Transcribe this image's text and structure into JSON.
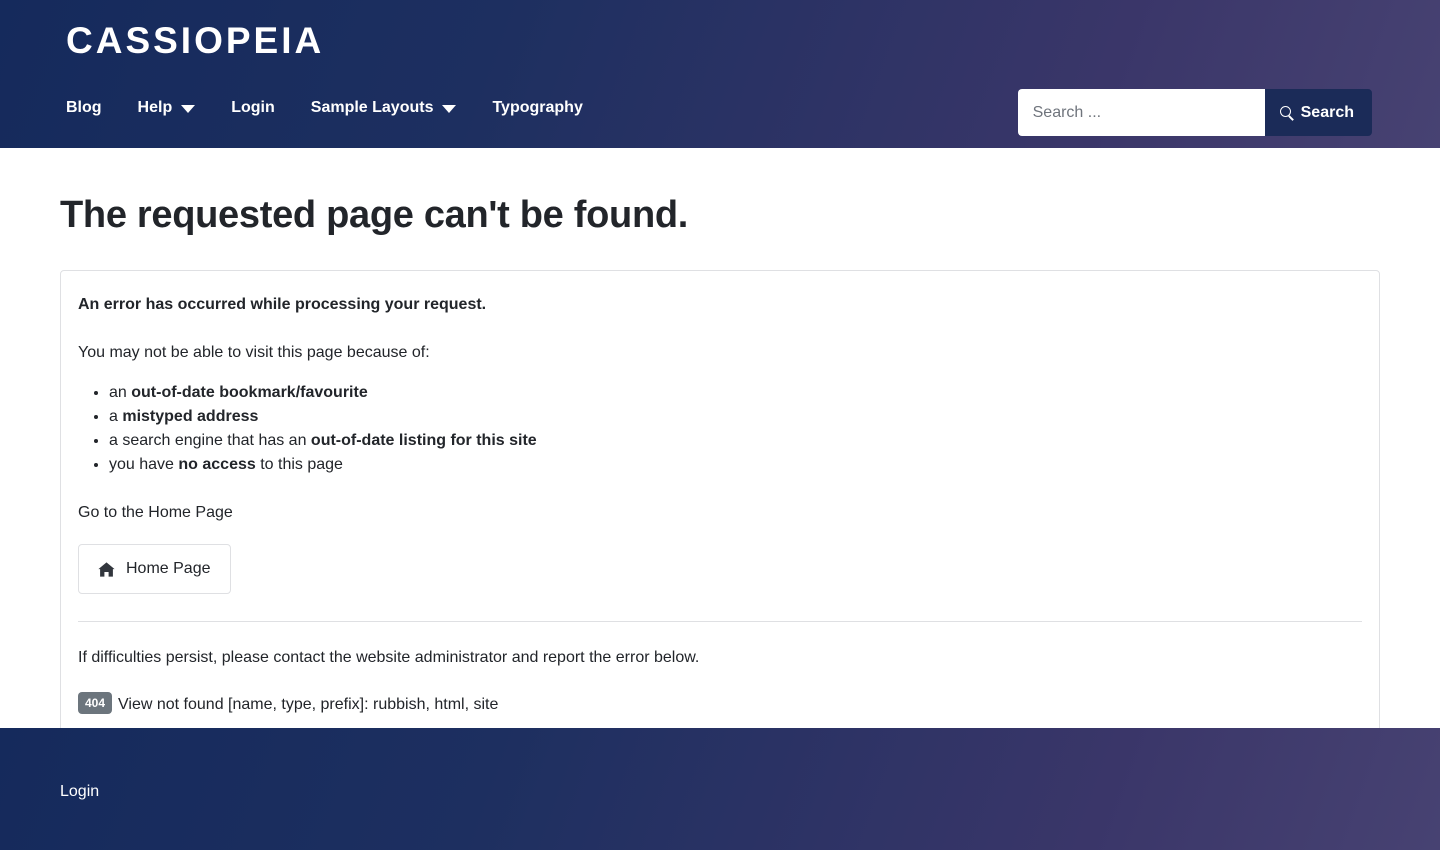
{
  "header": {
    "brand": "CASSIOPEIA",
    "nav": [
      {
        "label": "Blog",
        "has_dropdown": false
      },
      {
        "label": "Help",
        "has_dropdown": true
      },
      {
        "label": "Login",
        "has_dropdown": false
      },
      {
        "label": "Sample Layouts",
        "has_dropdown": true
      },
      {
        "label": "Typography",
        "has_dropdown": false
      }
    ],
    "search": {
      "placeholder": "Search ...",
      "value": "",
      "button_label": "Search",
      "button_icon": "search-icon"
    },
    "gradient_from": "#152a5c",
    "gradient_to": "#474272"
  },
  "main": {
    "page_title": "The requested page can't be found.",
    "error_card": {
      "lead": "An error has occurred while processing your request.",
      "intro": "You may not be able to visit this page because of:",
      "reasons": [
        {
          "prefix": "an ",
          "strong": "out-of-date bookmark/favourite",
          "suffix": ""
        },
        {
          "prefix": "a ",
          "strong": "mistyped address",
          "suffix": ""
        },
        {
          "prefix": "a search engine that has an ",
          "strong": "out-of-date listing for this site",
          "suffix": ""
        },
        {
          "prefix": "you have ",
          "strong": "no access",
          "suffix": " to this page"
        }
      ],
      "home_prompt": "Go to the Home Page",
      "home_button": {
        "label": "Home Page",
        "icon": "home-icon"
      },
      "persist_note": "If difficulties persist, please contact the website administrator and report the error below.",
      "error_code": "404",
      "error_code_color": "#6c757d",
      "error_message": "View not found [name, type, prefix]: rubbish, html, site"
    }
  },
  "footer": {
    "links": [
      {
        "label": "Login"
      }
    ]
  }
}
